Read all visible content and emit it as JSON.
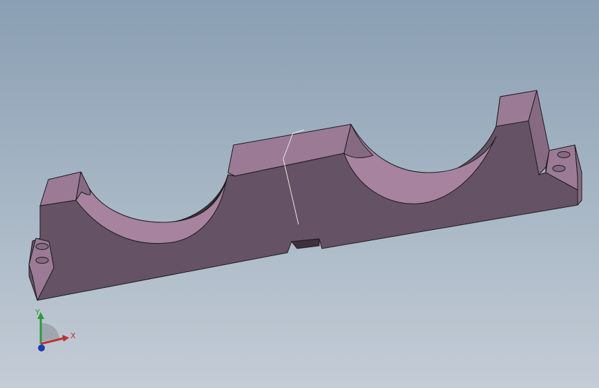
{
  "viewport": {
    "background_top": "#8a9fb3",
    "background_bottom": "#c4ccd6"
  },
  "model": {
    "description_icon": "split-bearing-block-model",
    "colors": {
      "front_face": "#655264",
      "top_face": "#9b7a96",
      "saddle_face": "#b08aa9",
      "end_face": "#866a82",
      "edge": "#1b1b1b",
      "split_line": "#e8e8e8"
    }
  },
  "triad": {
    "x_label": "X",
    "y_label": "Y",
    "x_color": "#c0302a",
    "y_color": "#2c9a3a",
    "z_color": "#1d3cb0"
  }
}
